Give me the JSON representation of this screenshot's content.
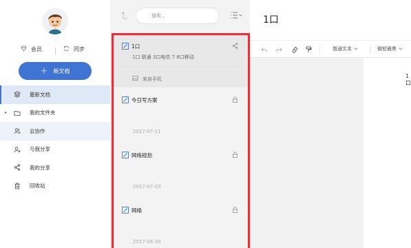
{
  "sidebar": {
    "vip_label": "会员",
    "sync_label": "同步",
    "new_doc_label": "新文档",
    "nav": [
      {
        "label": "最新文档",
        "icon": "layers-icon"
      },
      {
        "label": "我的文件夹",
        "icon": "folder-icon"
      },
      {
        "label": "云协作",
        "icon": "users-icon"
      },
      {
        "label": "与我分享",
        "icon": "user-share-icon"
      },
      {
        "label": "我的分享",
        "icon": "share-icon"
      },
      {
        "label": "回收站",
        "icon": "trash-icon"
      }
    ]
  },
  "list": {
    "search_placeholder": "搜索...",
    "docs": [
      {
        "title": "1口",
        "snippet": "1口 联通 3口电信 7 8口移动",
        "source": "来自手机",
        "action_icon": "share-icon"
      },
      {
        "title": "今日写方案",
        "date": "2017-07-11",
        "action_icon": "lock-icon"
      },
      {
        "title": "网络规划",
        "date": "2017-07-03",
        "action_icon": "lock-icon"
      },
      {
        "title": "网络",
        "date": "2017-06-30",
        "action_icon": "lock-icon"
      }
    ]
  },
  "editor": {
    "title": "1口",
    "paragraph_style": "普通文本",
    "font_family": "微软雅黑",
    "body_text": "1口"
  },
  "colors": {
    "accent": "#3f73d4",
    "highlight_border": "#e0343d",
    "sidebar_active": "#dfe8f6"
  }
}
